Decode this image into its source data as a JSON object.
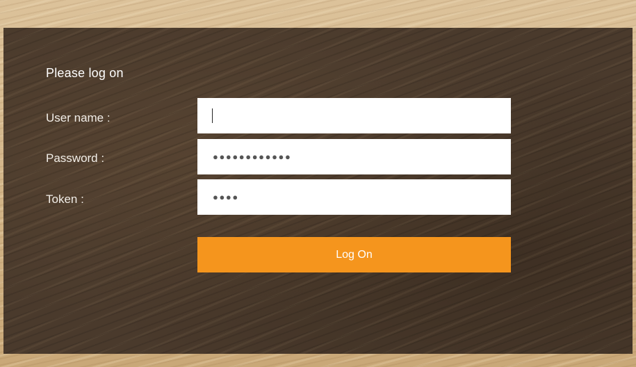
{
  "login": {
    "heading": "Please log on",
    "fields": {
      "username": {
        "label": "User name :",
        "value": ""
      },
      "password": {
        "label": "Password :",
        "masked_value": "●●●●●●●●●●●●"
      },
      "token": {
        "label": "Token :",
        "masked_value": "●●●●"
      }
    },
    "submit_label": "Log On"
  },
  "colors": {
    "accent": "#f5951d",
    "panel": "#4a3a2c",
    "input_bg": "#ffffff",
    "text": "#ffffff"
  }
}
